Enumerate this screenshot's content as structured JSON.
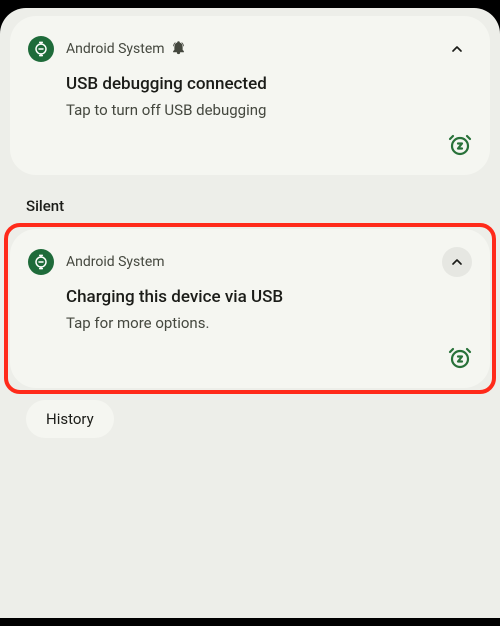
{
  "notifications": [
    {
      "app": "Android System",
      "title": "USB debugging connected",
      "text": "Tap to turn off USB debugging",
      "hasBell": true
    },
    {
      "app": "Android System",
      "title": "Charging this device via USB",
      "text": "Tap for more options.",
      "hasBell": false
    }
  ],
  "sectionLabel": "Silent",
  "historyLabel": "History"
}
